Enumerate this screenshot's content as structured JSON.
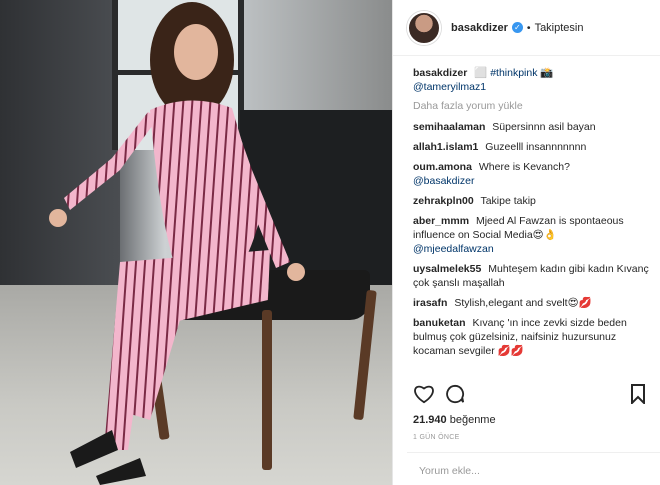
{
  "post": {
    "username": "basakdizer",
    "follow_status": "Takiptesin",
    "caption": {
      "user": "basakdizer",
      "text": "⬜ #thinkpink 📸",
      "mention": "@tameryilmaz1"
    },
    "load_more": "Daha fazla yorum yükle",
    "comments": [
      {
        "user": "semihaalaman",
        "text": "Süpersinnn asil bayan",
        "mention": ""
      },
      {
        "user": "allah1.islam1",
        "text": "Guzeelll insannnnnnn",
        "mention": ""
      },
      {
        "user": "oum.amona",
        "text": "Where is Kevanch?",
        "mention": "@basakdizer"
      },
      {
        "user": "zehrakpln00",
        "text": "Takipe takip",
        "mention": ""
      },
      {
        "user": "aber_mmm",
        "text": "Mjeed Al Fawzan is spontaeous influence on Social Media😍👌",
        "mention": "@mjeedalfawzan"
      },
      {
        "user": "uysalmelek55",
        "text": "Muhteşem kadın gibi kadın Kıvanç çok şanslı maşallah",
        "mention": ""
      },
      {
        "user": "irasafn",
        "text": "Stylish,elegant and svelt😍💋",
        "mention": ""
      },
      {
        "user": "banuketan",
        "text": "Kıvanç 'ın ince zevki sizde beden bulmuş çok güzelsiniz, naifsiniz huzursunuz kocaman sevgiler 💋💋",
        "mention": ""
      }
    ],
    "likes_count": "21.940",
    "likes_label": "beğenme",
    "time_ago": "1 GÜN ÖNCE",
    "comment_placeholder": "Yorum ekle..."
  },
  "icons": {
    "like": "heart-icon",
    "comment": "comment-bubble-icon",
    "save": "bookmark-icon",
    "verified": "verified-badge-icon"
  },
  "colors": {
    "link": "#003569",
    "verified": "#3897f0",
    "muted": "#999999"
  }
}
